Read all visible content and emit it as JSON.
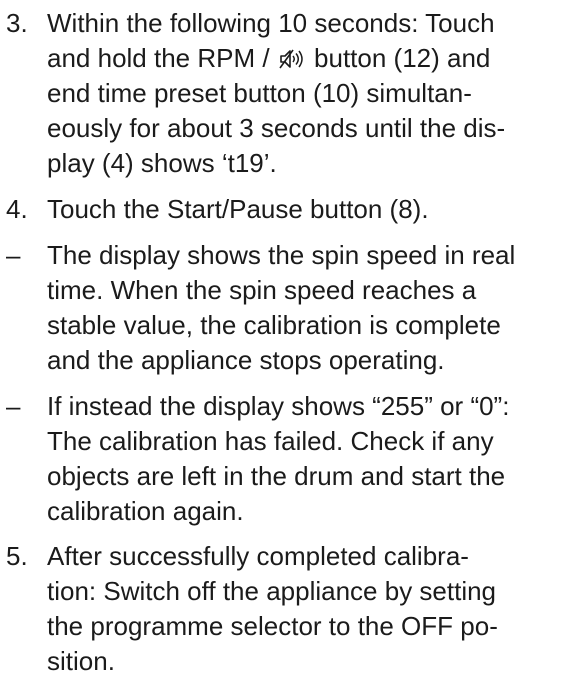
{
  "steps": [
    {
      "marker": "3.",
      "lines_before_icon": "Within the following 10 seconds: Touch",
      "line2_prefix": "and hold the RPM / ",
      "icon": "sound-mute-icon",
      "line2_suffix": " button (12) and",
      "lines": [
        "end time preset button (10) simultan-",
        "eously for about 3 seconds until the dis-",
        "play (4) shows ‘t19’."
      ]
    },
    {
      "marker": "4.",
      "lines": [
        "Touch the Start/Pause button (8)."
      ]
    },
    {
      "marker": "–",
      "lines": [
        "The display shows the spin speed in real",
        "time. When the spin speed reaches a",
        "stable value, the calibration is complete",
        "and the appliance stops operating."
      ]
    },
    {
      "marker": "–",
      "lines": [
        "If instead the display shows “255” or “0”:",
        "The calibration has failed. Check if any",
        "objects are left in the drum and start the",
        "calibration again."
      ]
    },
    {
      "marker": "5.",
      "lines": [
        "After successfully completed calibra-",
        "tion: Switch off the appliance by setting",
        "the programme selector to the OFF po-",
        "sition."
      ]
    }
  ]
}
